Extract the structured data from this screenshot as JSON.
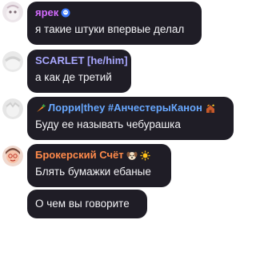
{
  "messages": [
    {
      "author": "ярек",
      "author_color": "#d46bff",
      "text": "я такие штуки впервые делал"
    },
    {
      "author": "SCARLET [he/him]",
      "author_color": "#a9a8ff",
      "text": "а как де третий"
    },
    {
      "author": "Лорри|they #АнчестерыКанон",
      "author_color": "#68a8ff",
      "text": "Буду ее называть чебурашка"
    },
    {
      "author": "Брокерский Счёт",
      "author_color": "#ff8a4a",
      "text": "Блять бумажки ебаные"
    },
    {
      "text": "О чем вы говорите"
    }
  ]
}
